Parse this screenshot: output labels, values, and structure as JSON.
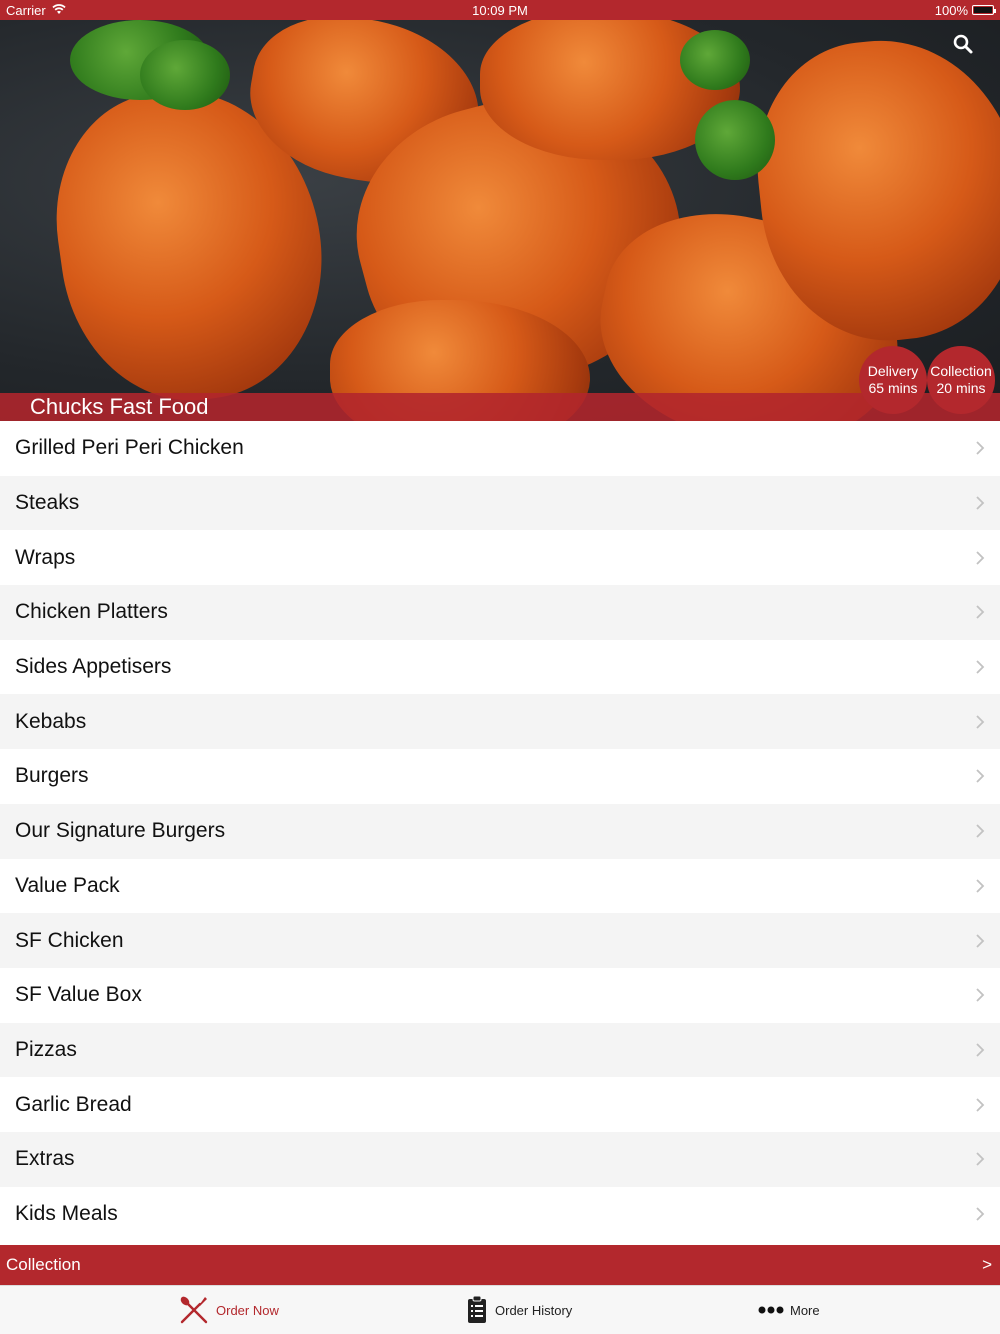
{
  "status_bar": {
    "carrier": "Carrier",
    "time": "10:09 PM",
    "battery": "100%"
  },
  "hero": {
    "restaurant_name": "Chucks Fast Food",
    "search_icon": "search-icon",
    "delivery": {
      "label": "Delivery",
      "time": "65 mins"
    },
    "collection": {
      "label": "Collection",
      "time": "20 mins"
    }
  },
  "menu": {
    "categories": [
      {
        "label": "Grilled Peri Peri Chicken"
      },
      {
        "label": "Steaks"
      },
      {
        "label": "Wraps"
      },
      {
        "label": "Chicken Platters"
      },
      {
        "label": "Sides Appetisers"
      },
      {
        "label": "Kebabs"
      },
      {
        "label": "Burgers"
      },
      {
        "label": "Our Signature Burgers"
      },
      {
        "label": "Value Pack"
      },
      {
        "label": "SF Chicken"
      },
      {
        "label": "SF Value Box"
      },
      {
        "label": "Pizzas"
      },
      {
        "label": "Garlic Bread"
      },
      {
        "label": "Extras"
      },
      {
        "label": "Kids Meals"
      }
    ]
  },
  "collection_bar": {
    "label": "Collection",
    "arrow": ">"
  },
  "tab_bar": {
    "order_now": "Order Now",
    "order_history": "Order History",
    "more": "More"
  },
  "colors": {
    "accent": "#b3282d",
    "row_alt": "#f4f4f4",
    "tab_bar_bg": "#f7f7f7"
  }
}
